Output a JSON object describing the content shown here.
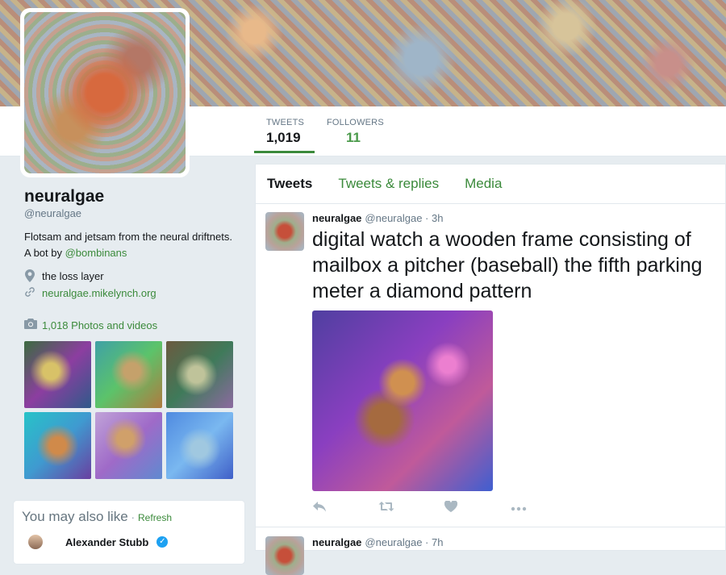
{
  "profile": {
    "name": "neuralgae",
    "handle": "@neuralgae",
    "bio_text": "Flotsam and jetsam from the neural driftnets. A bot by ",
    "bio_link": "@bombinans",
    "location": "the loss layer",
    "website": "neuralgae.mikelynch.org",
    "photos_label": "1,018 Photos and videos"
  },
  "stats": {
    "tweets_label": "TWEETS",
    "tweets_value": "1,019",
    "followers_label": "FOLLOWERS",
    "followers_value": "11"
  },
  "timeline": {
    "tabs": [
      "Tweets",
      "Tweets & replies",
      "Media"
    ]
  },
  "tweets": [
    {
      "name": "neuralgae",
      "handle": "@neuralgae · 3h",
      "text": "digital watch a wooden frame consisting of mailbox a pitcher (baseball) the fifth parking meter a diamond pattern"
    },
    {
      "name": "neuralgae",
      "handle": "@neuralgae · 7h"
    }
  ],
  "who_to_follow": {
    "title": "You may also like",
    "refresh": "Refresh",
    "suggestion_name": "Alexander Stubb"
  },
  "icons": {
    "location": "map-pin-icon",
    "link": "link-icon",
    "camera": "camera-icon",
    "reply": "reply-icon",
    "retweet": "retweet-icon",
    "like": "heart-icon",
    "more": "more-icon",
    "verified": "verified-badge-icon"
  },
  "colors": {
    "accent": "#3b8a3b",
    "background": "#e6ecf0"
  }
}
